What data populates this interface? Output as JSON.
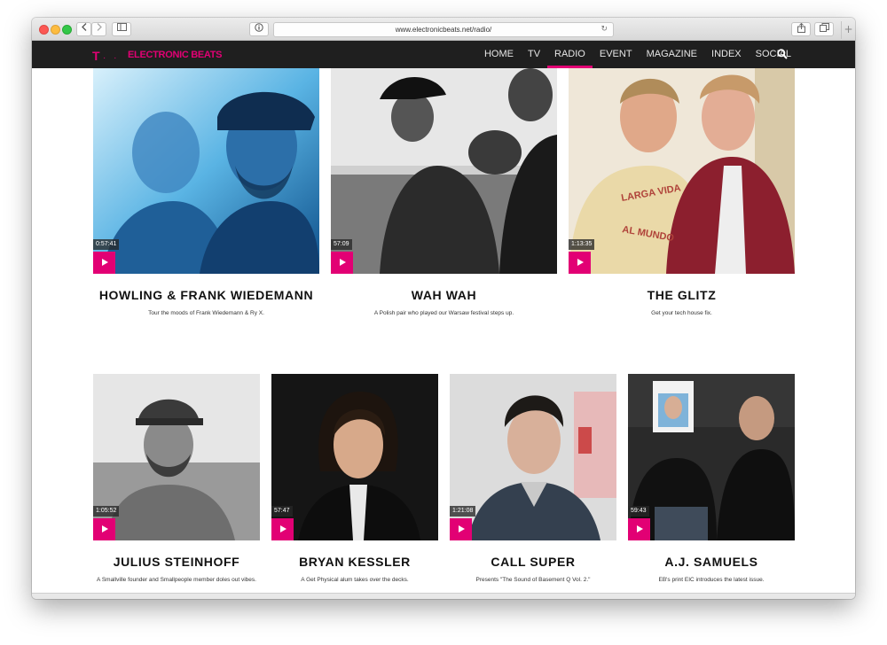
{
  "browser": {
    "url": "www.electronicbeats.net/radio/",
    "reload_glyph": "↻",
    "plus_glyph": "+"
  },
  "site": {
    "logo_mark": "T",
    "logo_dots": "· ·",
    "brand": "ELECTRONIC BEATS",
    "nav": [
      "HOME",
      "TV",
      "RADIO",
      "EVENT",
      "MAGAZINE",
      "INDEX",
      "SOCIAL"
    ],
    "active_nav": "RADIO",
    "accent_color": "#e20074"
  },
  "row1": [
    {
      "title": "HOWLING & FRANK WIEDEMANN",
      "description": "Tour the moods of Frank Wiedemann & Ry X.",
      "duration": "0:57:41"
    },
    {
      "title": "WAH WAH",
      "description": "A Polish pair who played our Warsaw festival steps up.",
      "duration": "57:09"
    },
    {
      "title": "THE GLITZ",
      "description": "Get your tech house fix.",
      "duration": "1:13:35"
    }
  ],
  "row2": [
    {
      "title": "JULIUS STEINHOFF",
      "description": "A Smallville founder and Smallpeople member doles out vibes.",
      "duration": "1:05:52"
    },
    {
      "title": "BRYAN KESSLER",
      "description": "A Get Physical alum takes over the decks.",
      "duration": "57:47"
    },
    {
      "title": "CALL SUPER",
      "description": "Presents \"The Sound of Basement Q Vol. 2.\"",
      "duration": "1:21:08"
    },
    {
      "title": "A.J. SAMUELS",
      "description": "EB's print EIC introduces the latest issue.",
      "duration": "59:43"
    }
  ]
}
